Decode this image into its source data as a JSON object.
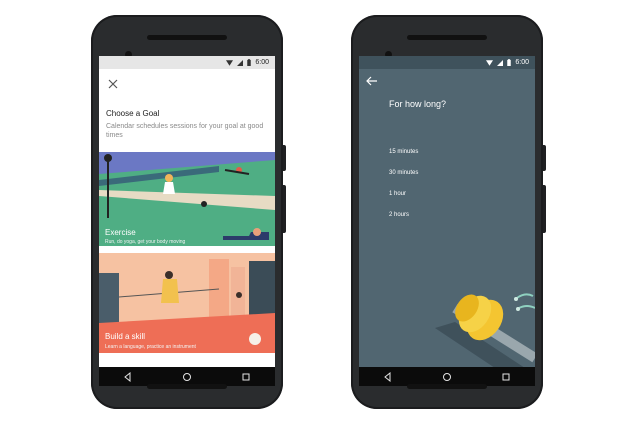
{
  "left_screen": {
    "status": {
      "time": "6:00"
    },
    "title": "Choose a Goal",
    "description": "Calendar schedules sessions for your goal at good times",
    "cards": [
      {
        "label": "Exercise",
        "subtitle": "Run, do yoga, get your body moving"
      },
      {
        "label": "Build a skill",
        "subtitle": "Learn a language, practice an instrument"
      }
    ]
  },
  "right_screen": {
    "status": {
      "time": "6:00"
    },
    "title": "For how long?",
    "options": [
      "15 minutes",
      "30 minutes",
      "1 hour",
      "2 hours"
    ]
  },
  "icons": {
    "close": "close-icon",
    "back": "arrow-back-icon",
    "wifi": "wifi-icon",
    "signal": "signal-icon",
    "battery": "battery-icon",
    "nav_back": "nav-back-icon",
    "nav_home": "nav-home-icon",
    "nav_recents": "nav-recents-icon"
  },
  "colors": {
    "right_bg": "#516671",
    "exercise_sky": "#6b78c4",
    "exercise_grass": "#4fae84",
    "skill_bg": "#f6c2a2",
    "skill_roof": "#ee6e56"
  }
}
